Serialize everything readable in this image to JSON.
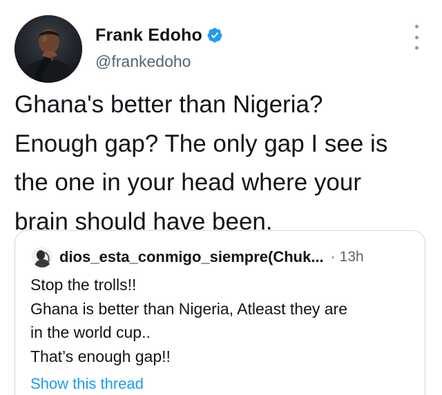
{
  "tweet": {
    "author_name": "Frank Edoho",
    "handle": "@frankedoho",
    "verified_icon": "verified-badge-icon",
    "more_icon": "more-vertical-icon",
    "text_lines": [
      "Ghana's better than Nigeria?",
      "Enough gap? The only gap I see is",
      "the one in your head where your",
      "brain should have been."
    ]
  },
  "quote": {
    "author_name": "dios_esta_conmigo_siempre(Chuk...",
    "separator": "·",
    "time": "13h",
    "text_lines": [
      "Stop the trolls!!",
      "Ghana is better than Nigeria, Atleast they are",
      "in the world cup..",
      "That’s enough gap!!"
    ],
    "show_thread_label": "Show this thread"
  },
  "colors": {
    "text_primary": "#0f1419",
    "text_secondary": "#536471",
    "link": "#1d9bf0",
    "verified": "#1d9bf0",
    "card_border": "#cfd9de"
  }
}
